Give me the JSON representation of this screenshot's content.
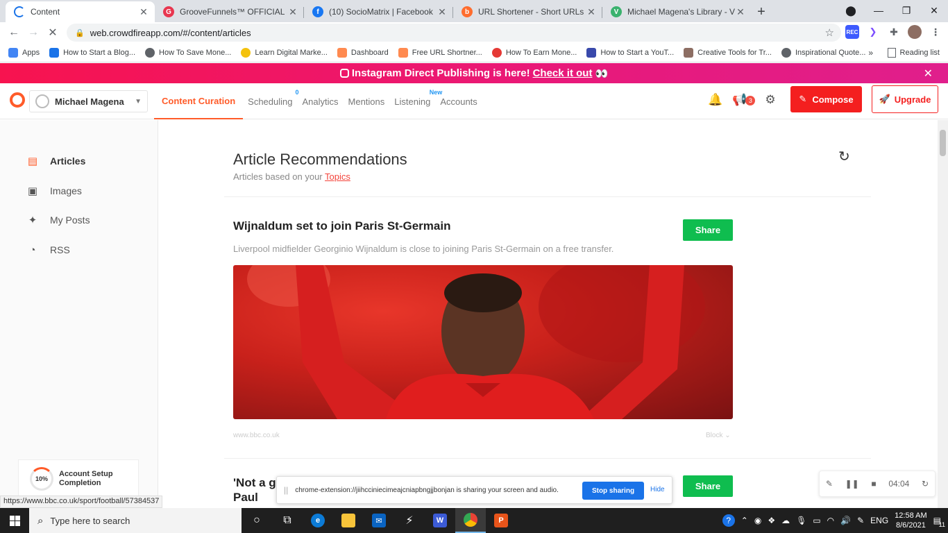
{
  "browser": {
    "tabs": [
      {
        "title": "Content",
        "active": true,
        "color": "#9aa0a6"
      },
      {
        "title": "GrooveFunnels™ OFFICIAL Site | G",
        "active": false,
        "color": "#e8364f"
      },
      {
        "title": "(10) SocioMatrix | Facebook",
        "active": false,
        "color": "#1877f2"
      },
      {
        "title": "URL Shortener - Short URLs & Cu",
        "active": false,
        "color": "#ff6d2e"
      },
      {
        "title": "Michael Magena's Library - Vidya",
        "active": false,
        "color": "#3ab26e"
      }
    ],
    "new_tab": "+",
    "url": "web.crowdfireapp.com/#/content/articles",
    "bookmarks": [
      {
        "label": "Apps",
        "color": "#4285f4"
      },
      {
        "label": "How to Start a Blog...",
        "color": "#1a73e8"
      },
      {
        "label": "How To Save Mone...",
        "color": "#5f6368"
      },
      {
        "label": "Learn Digital Marke...",
        "color": "#f4c20d"
      },
      {
        "label": "Dashboard",
        "color": "#ff8a50"
      },
      {
        "label": "Free URL Shortner...",
        "color": "#ff8a50"
      },
      {
        "label": "How To Earn Mone...",
        "color": "#e53935"
      },
      {
        "label": "How to Start a YouT...",
        "color": "#3949ab"
      },
      {
        "label": "Creative Tools for Tr...",
        "color": "#8d6e63"
      },
      {
        "label": "Inspirational Quote...",
        "color": "#5f6368"
      }
    ],
    "bookmarks_more": "»",
    "reading_list": "Reading list",
    "status_url": "https://www.bbc.co.uk/sport/football/57384537"
  },
  "promo": {
    "text": "Instagram Direct Publishing is here!",
    "link": "Check it out",
    "emoji": "👀"
  },
  "header": {
    "account_name": "Michael Magena",
    "nav": [
      {
        "label": "Content Curation",
        "active": true,
        "sup": ""
      },
      {
        "label": "Scheduling",
        "active": false,
        "sup": "0"
      },
      {
        "label": "Analytics",
        "active": false,
        "sup": ""
      },
      {
        "label": "Mentions",
        "active": false,
        "sup": ""
      },
      {
        "label": "Listening",
        "active": false,
        "sup": "New"
      },
      {
        "label": "Accounts",
        "active": false,
        "sup": ""
      }
    ],
    "notifications_badge": "3",
    "compose_label": "Compose",
    "upgrade_label": "Upgrade",
    "accent": "#ff5b29"
  },
  "sidebar": {
    "items": [
      {
        "label": "Articles",
        "icon": "articles-icon",
        "active": true
      },
      {
        "label": "Images",
        "icon": "image-icon",
        "active": false
      },
      {
        "label": "My Posts",
        "icon": "sparkle-icon",
        "active": false
      },
      {
        "label": "RSS",
        "icon": "rss-icon",
        "active": false
      }
    ],
    "setup": {
      "percent": "10%",
      "label": "Account Setup Completion"
    }
  },
  "main": {
    "title": "Article Recommendations",
    "subtitle": "Articles based on your",
    "topics_link": "Topics",
    "articles": [
      {
        "title": "Wijnaldum set to join Paris St-Germain",
        "description": "Liverpool midfielder Georginio Wijnaldum is close to joining Paris St-Germain on a free transfer.",
        "source": "www.bbc.co.uk",
        "block": "Block",
        "share": "Share"
      },
      {
        "title": "'Not a good look for Floyd' - how social media reacted to Mayweather vs Paul",
        "share": "Share"
      }
    ]
  },
  "screen_share": {
    "message": "chrome-extension://jiihcciniecimeajcniapbngjjbonjan is sharing your screen and audio.",
    "stop_label": "Stop sharing",
    "hide_label": "Hide"
  },
  "recorder": {
    "time": "04:04"
  },
  "taskbar": {
    "search_placeholder": "Type here to search",
    "lang": "ENG",
    "time": "12:58 AM",
    "date": "8/6/2021",
    "notif_count": "11"
  }
}
